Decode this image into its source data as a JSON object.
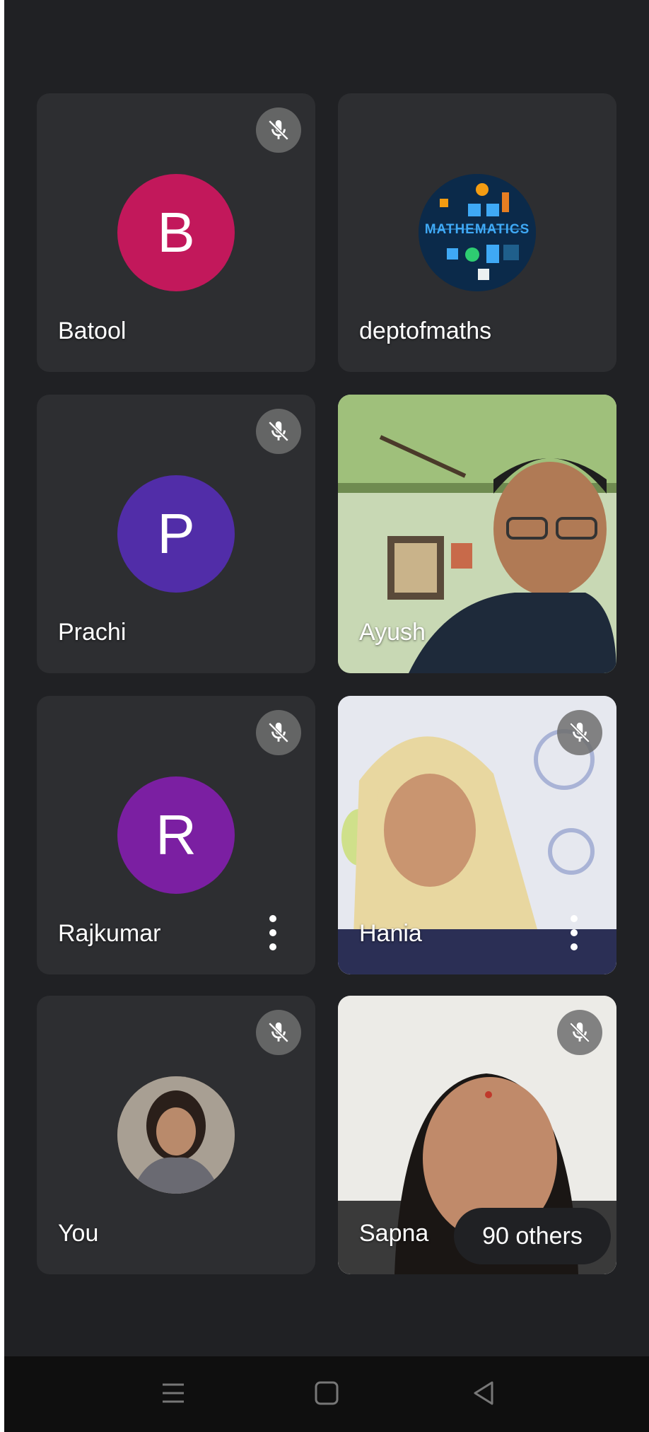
{
  "participants": [
    {
      "name": "Batool",
      "initial": "B",
      "avatar_color": "#c2185b",
      "muted": true
    },
    {
      "name": "deptofmaths",
      "logo_text": "MATHEMATICS",
      "muted": false
    },
    {
      "name": "Prachi",
      "initial": "P",
      "avatar_color": "#512da8",
      "muted": true
    },
    {
      "name": "Ayush",
      "video": true,
      "muted": false
    },
    {
      "name": "Rajkumar",
      "initial": "R",
      "avatar_color": "#7b1fa2",
      "muted": true,
      "more_menu": true
    },
    {
      "name": "Hania",
      "video": true,
      "muted": true,
      "more_menu": true
    },
    {
      "name": "You",
      "photo_avatar": true,
      "muted": true
    },
    {
      "name": "Sapna",
      "video": true,
      "muted": true
    }
  ],
  "others_label": "90 others",
  "icons": {
    "mute": "mic-off-icon",
    "more": "more-vert-icon",
    "nav": [
      "menu-icon",
      "home-square-icon",
      "back-triangle-icon"
    ]
  },
  "colors": {
    "background": "#202124",
    "tile": "#2d2e31",
    "navbar": "#0f0f0f"
  }
}
